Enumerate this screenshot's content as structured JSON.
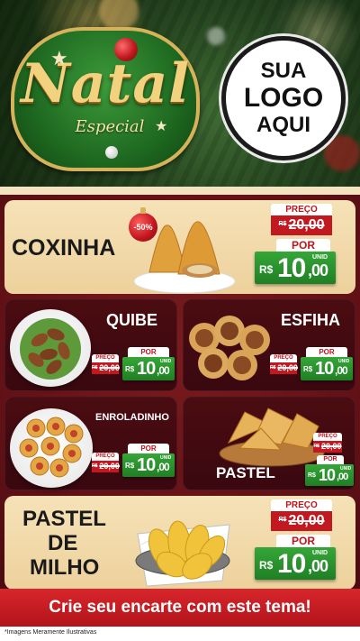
{
  "header": {
    "badge_title": "Natal",
    "badge_subtitle": "Especial",
    "logo_line1": "SUA",
    "logo_line2": "LOGO",
    "logo_line3": "AQUI"
  },
  "products": [
    {
      "name": "COXINHA",
      "discount": "-50%",
      "price_header": "PREÇO",
      "old_price_currency": "R$",
      "old_price": "20,00",
      "por_label": "POR",
      "currency": "R$",
      "price_int": "10",
      "price_dec": ",00",
      "unit": "UNID"
    },
    {
      "name": "QUIBE",
      "price_header": "PREÇO",
      "old_price_currency": "R$",
      "old_price": "20,00",
      "por_label": "POR",
      "currency": "R$",
      "price_int": "10",
      "price_dec": ",00",
      "unit": "UNID"
    },
    {
      "name": "ESFIHA",
      "price_header": "PREÇO",
      "old_price_currency": "R$",
      "old_price": "20,00",
      "por_label": "POR",
      "currency": "R$",
      "price_int": "10",
      "price_dec": ",00",
      "unit": "UNID"
    },
    {
      "name": "ENROLADINHO",
      "price_header": "PREÇO",
      "old_price_currency": "R$",
      "old_price": "20,00",
      "por_label": "POR",
      "currency": "R$",
      "price_int": "10",
      "price_dec": ",00",
      "unit": "UNID"
    },
    {
      "name": "PASTEL",
      "price_header": "PREÇO",
      "old_price_currency": "R$",
      "old_price": "20,00",
      "por_label": "POR",
      "currency": "R$",
      "price_int": "10",
      "price_dec": ",00",
      "unit": "UNID"
    },
    {
      "name_line1": "PASTEL",
      "name_line2": "DE",
      "name_line3": "MILHO",
      "price_header": "PREÇO",
      "old_price_currency": "R$",
      "old_price": "20,00",
      "por_label": "POR",
      "currency": "R$",
      "price_int": "10",
      "price_dec": ",00",
      "unit": "UNID"
    }
  ],
  "footer": {
    "banner": "Crie seu encarte com este tema!",
    "disclaimer": "*Imagens Meramente Ilustrativas"
  },
  "colors": {
    "cream": "#f6e2b8",
    "dark_card": "#4a0c11",
    "red": "#c21820",
    "green": "#2a9a2e",
    "banner_red": "#d8262c"
  }
}
